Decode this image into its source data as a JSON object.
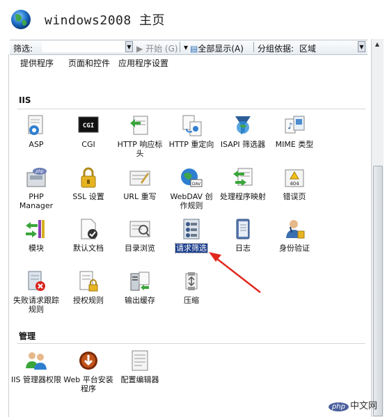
{
  "header": {
    "title": "windows2008 主页"
  },
  "toolbar": {
    "filter_label": "筛选:",
    "filter_value": "",
    "start_label": "开始",
    "start_key": "(G)",
    "showall_label": "全部显示",
    "showall_key": "(A)",
    "groupby_label": "分组依据:",
    "groupby_value": "区域"
  },
  "top_partial": [
    "提供程序",
    "页面和控件",
    "应用程序设置"
  ],
  "sections": {
    "iis_title": "IIS",
    "manage_title": "管理"
  },
  "iis_items": [
    {
      "label": "ASP",
      "icon": "asp-icon"
    },
    {
      "label": "CGI",
      "icon": "cgi-icon"
    },
    {
      "label": "HTTP 响应标头",
      "icon": "http-response-headers-icon"
    },
    {
      "label": "HTTP 重定向",
      "icon": "http-redirect-icon"
    },
    {
      "label": "ISAPI 筛选器",
      "icon": "isapi-filters-icon"
    },
    {
      "label": "MIME 类型",
      "icon": "mime-types-icon"
    },
    {
      "label": "PHP Manager",
      "icon": "php-manager-icon"
    },
    {
      "label": "SSL 设置",
      "icon": "lock-icon"
    },
    {
      "label": "URL 重写",
      "icon": "url-rewrite-icon"
    },
    {
      "label": "WebDAV 创作规则",
      "icon": "webdav-icon"
    },
    {
      "label": "处理程序映射",
      "icon": "handler-mappings-icon"
    },
    {
      "label": "错误页",
      "icon": "error-pages-icon"
    },
    {
      "label": "模块",
      "icon": "modules-icon"
    },
    {
      "label": "默认文档",
      "icon": "default-document-icon"
    },
    {
      "label": "目录浏览",
      "icon": "directory-browsing-icon"
    },
    {
      "label": "请求筛选",
      "icon": "request-filtering-icon"
    },
    {
      "label": "日志",
      "icon": "logging-icon"
    },
    {
      "label": "身份验证",
      "icon": "authentication-icon"
    },
    {
      "label": "失败请求跟踪规则",
      "icon": "failed-request-tracing-icon"
    },
    {
      "label": "授权规则",
      "icon": "authorization-rules-icon"
    },
    {
      "label": "输出缓存",
      "icon": "output-caching-icon"
    },
    {
      "label": "压缩",
      "icon": "compression-icon"
    }
  ],
  "manage_items": [
    {
      "label": "IIS 管理器权限",
      "icon": "iis-manager-permissions-icon"
    },
    {
      "label": "Web 平台安装程序",
      "icon": "web-platform-installer-icon"
    },
    {
      "label": "配置编辑器",
      "icon": "configuration-editor-icon"
    }
  ],
  "selected_item": "请求筛选",
  "watermark": "中文网",
  "watermark_badge": "php",
  "colors": {
    "selection": "#1c3e8c",
    "arrow": "#e0281e"
  }
}
